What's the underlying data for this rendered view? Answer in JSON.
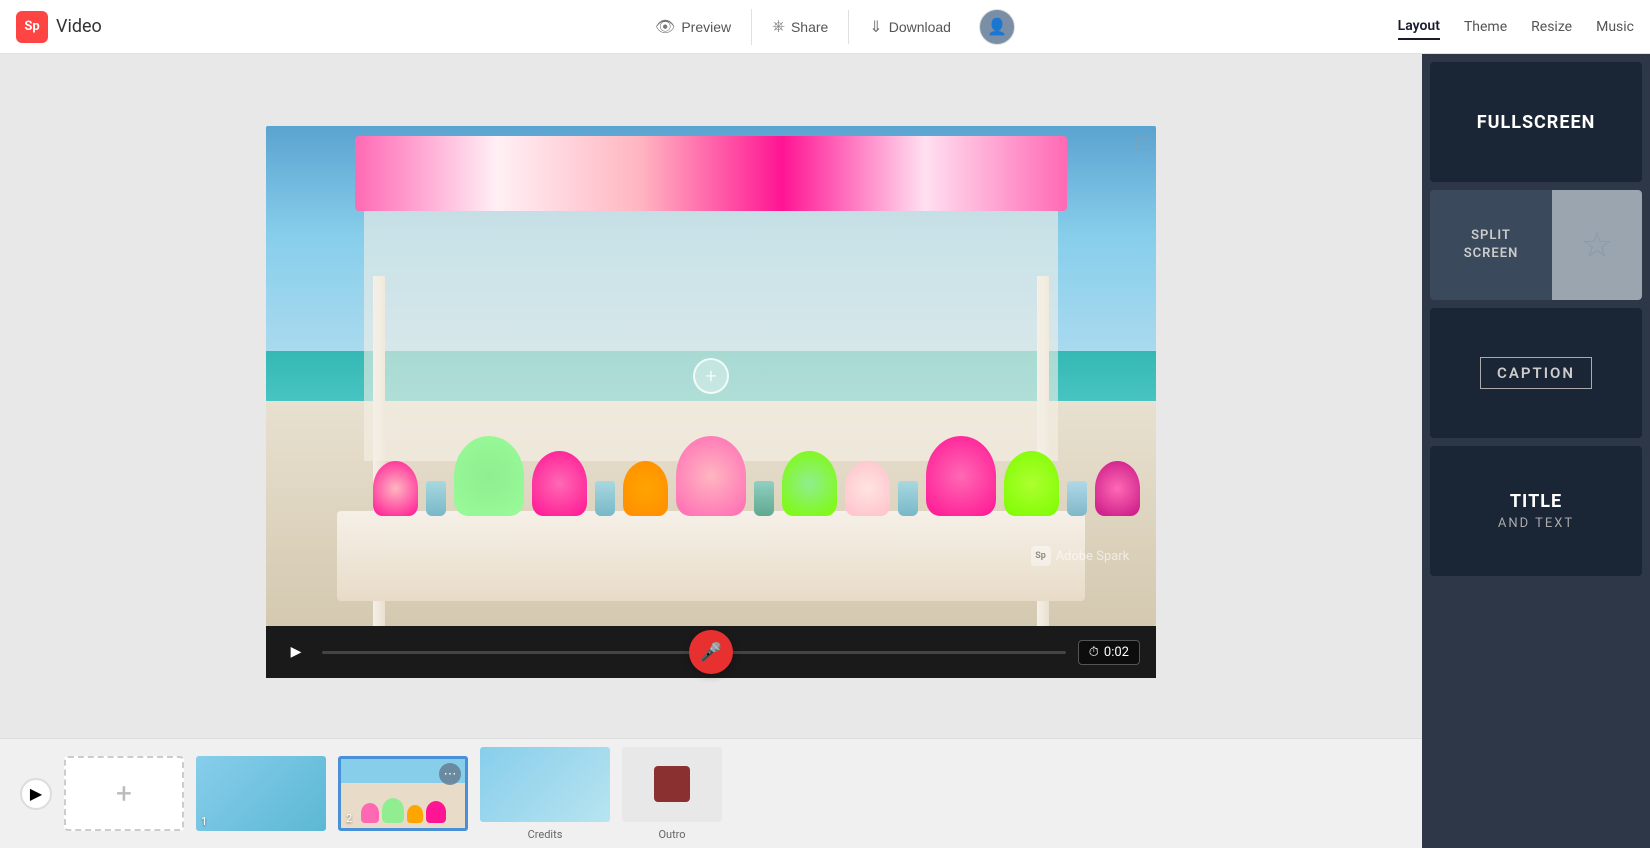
{
  "header": {
    "logo_sp": "Sp",
    "logo_text": "Video",
    "preview_label": "Preview",
    "share_label": "Share",
    "download_label": "Download",
    "nav_layout": "Layout",
    "nav_theme": "Theme",
    "nav_resize": "Resize",
    "nav_music": "Music"
  },
  "controls": {
    "time": "0:02"
  },
  "layouts": {
    "fullscreen_label": "FULLSCREEN",
    "split_screen_label": "SPLIT\nSCREEN",
    "caption_label": "CAPTION",
    "title_label": "TITLE",
    "and_text_label": "AND TEXT"
  },
  "timeline": {
    "slide_1_num": "1",
    "slide_2_num": "2",
    "credits_label": "Credits",
    "outro_label": "Outro",
    "add_slide_label": "+"
  },
  "watermark": {
    "sp": "Sp",
    "text": "Adobe Spark"
  }
}
